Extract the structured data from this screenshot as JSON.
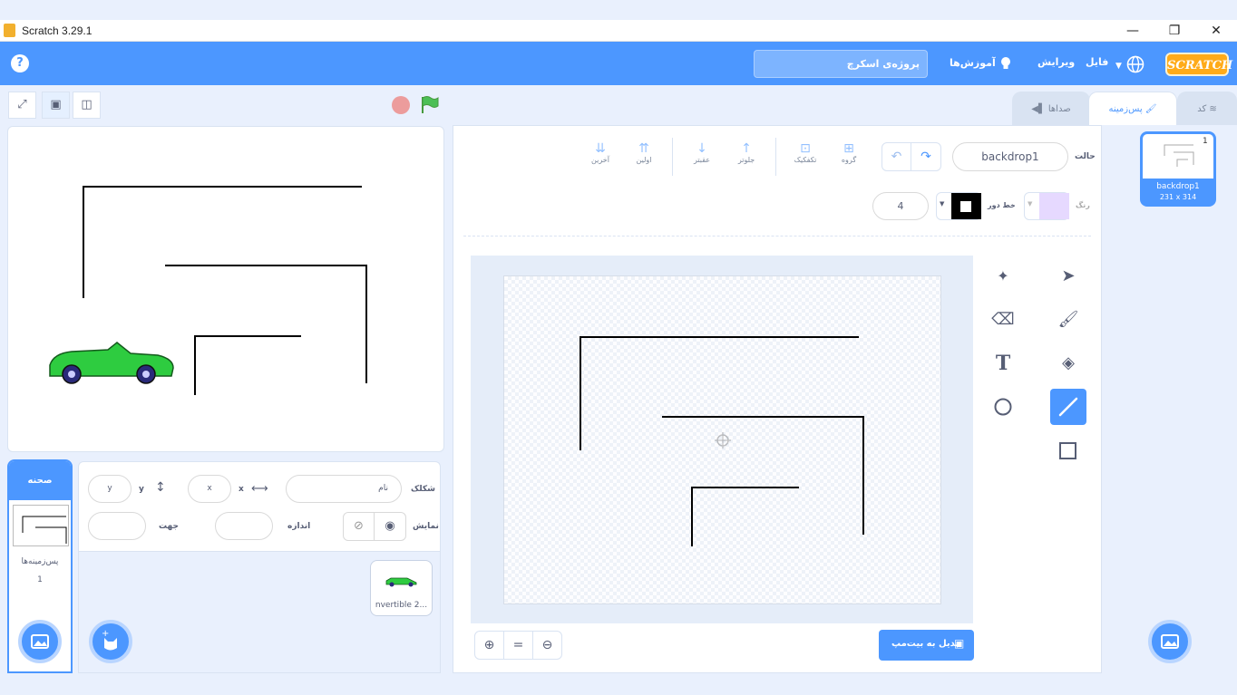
{
  "window": {
    "title": "Scratch 3.29.1",
    "min_glyph": "—",
    "restore_glyph": "❐",
    "close_glyph": "✕"
  },
  "menubar": {
    "help_glyph": "?",
    "project_title": "پروژه‌ی اسکرچ",
    "tutorials": "آموزش‌ها",
    "edit": "ویرایش",
    "file": "فایل",
    "logo": "SCRATCH",
    "accent": "#4c97ff"
  },
  "stage_controls": {
    "fullscreen_glyph": "⤢",
    "small_stage_glyph": "▣",
    "large_stage_glyph": "◫"
  },
  "tabs": {
    "code": "کد",
    "backdrops": "پس‌زمینه",
    "sounds": "صداها"
  },
  "paint_editor": {
    "costume_label": "حالت",
    "costume_name": "backdrop1",
    "fill_label": "رنگ",
    "outline_label": "خط دور",
    "outline_width": "4",
    "fill_color": "#e6d9ff",
    "outline_color": "#000000",
    "arrange": {
      "back": "آخرین",
      "front": "اولین",
      "backward": "عقبتر",
      "forward": "جلوتر",
      "ungroup": "تکفکیک",
      "group": "گروه"
    },
    "convert_button": "تبدیل به بیت‌مپ",
    "zoom_in_glyph": "⊕",
    "zoom_reset_glyph": "=",
    "zoom_out_glyph": "⊖"
  },
  "backdrop_list": [
    {
      "index": "1",
      "name": "backdrop1",
      "size": "231 x 314"
    }
  ],
  "sprite_info": {
    "sprite_label": "شکلک",
    "name_placeholder": "نام",
    "x_label": "x",
    "x_value": "x",
    "y_label": "y",
    "y_value": "y",
    "show_label": "نمایش",
    "size_label": "اندازه",
    "direction_label": "جهت"
  },
  "sprites": [
    {
      "name": "nvertible 2..."
    }
  ],
  "stage_panel": {
    "header": "صحنه",
    "backdrops_label": "پس‌زمینه‌ها",
    "backdrops_count": "1"
  }
}
